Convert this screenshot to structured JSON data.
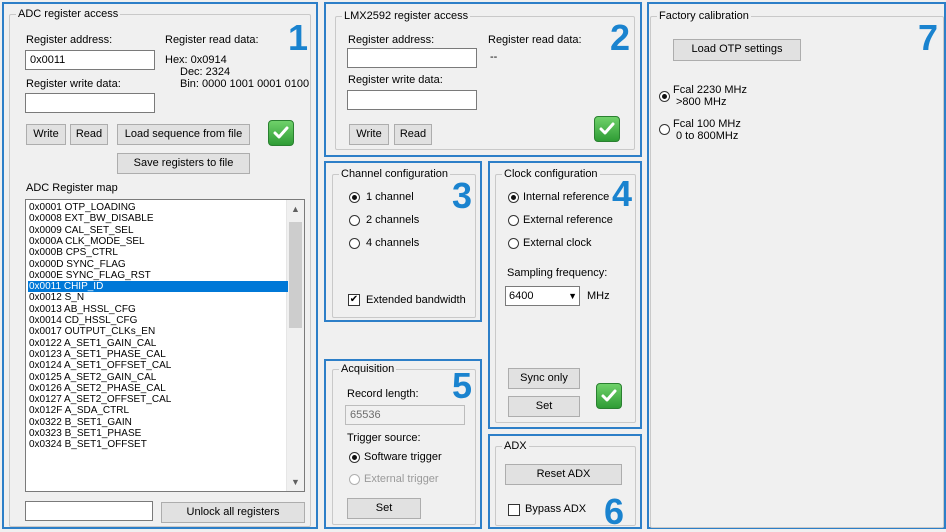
{
  "panel1": {
    "number": "1",
    "group_title": "ADC register access",
    "register_address_label": "Register address:",
    "register_address_value": "0x0011",
    "register_read_data_label": "Register read data:",
    "read_hex": "Hex: 0x0914",
    "read_dec": "Dec: 2324",
    "read_bin": "Bin: 0000 1001 0001 0100",
    "register_write_data_label": "Register write data:",
    "register_write_data_value": "",
    "write_button": "Write",
    "read_button": "Read",
    "load_sequence_button": "Load sequence from file",
    "save_registers_button": "Save registers to file",
    "register_map_label": "ADC Register map",
    "register_map": [
      "0x0001 OTP_LOADING",
      "0x0008 EXT_BW_DISABLE",
      "0x0009 CAL_SET_SEL",
      "0x000A CLK_MODE_SEL",
      "0x000B CPS_CTRL",
      "0x000D SYNC_FLAG",
      "0x000E SYNC_FLAG_RST",
      "0x0011 CHIP_ID",
      "0x0012 S_N",
      "0x0013 AB_HSSL_CFG",
      "0x0014 CD_HSSL_CFG",
      "0x0017 OUTPUT_CLKs_EN",
      "0x0122 A_SET1_GAIN_CAL",
      "0x0123 A_SET1_PHASE_CAL",
      "0x0124 A_SET1_OFFSET_CAL",
      "0x0125 A_SET2_GAIN_CAL",
      "0x0126 A_SET2_PHASE_CAL",
      "0x0127 A_SET2_OFFSET_CAL",
      "0x012F A_SDA_CTRL",
      "0x0322 B_SET1_GAIN",
      "0x0323 B_SET1_PHASE",
      "0x0324 B_SET1_OFFSET"
    ],
    "selected_index": 7,
    "unlock_input_value": "",
    "unlock_button": "Unlock all registers"
  },
  "panel2": {
    "number": "2",
    "group_title": "LMX2592 register access",
    "register_address_label": "Register address:",
    "register_address_value": "",
    "register_read_data_label": "Register read data:",
    "read_value": "--",
    "register_write_data_label": "Register write data:",
    "register_write_data_value": "",
    "write_button": "Write",
    "read_button": "Read"
  },
  "panel3": {
    "number": "3",
    "group_title": "Channel configuration",
    "options": [
      "1 channel",
      "2 channels",
      "4 channels"
    ],
    "selected_option": 0,
    "extended_bandwidth_label": "Extended bandwidth",
    "extended_bandwidth_checked": true
  },
  "panel4": {
    "number": "4",
    "group_title": "Clock configuration",
    "options": [
      "Internal reference",
      "External reference",
      "External clock"
    ],
    "selected_option": 0,
    "sampling_frequency_label": "Sampling frequency:",
    "sampling_frequency_value": "6400",
    "sampling_frequency_unit": "MHz",
    "sync_only_button": "Sync only",
    "set_button": "Set"
  },
  "panel5": {
    "number": "5",
    "group_title": "Acquisition",
    "record_length_label": "Record length:",
    "record_length_value": "65536",
    "trigger_source_label": "Trigger source:",
    "software_trigger_label": "Software trigger",
    "external_trigger_label": "External trigger",
    "set_button": "Set"
  },
  "panel6": {
    "number": "6",
    "group_title": "ADX",
    "reset_button": "Reset ADX",
    "bypass_label": "Bypass ADX",
    "bypass_checked": false
  },
  "panel7": {
    "number": "7",
    "group_title": "Factory calibration",
    "load_otp_button": "Load OTP settings",
    "fcal_2230_line1": "Fcal 2230 MHz",
    "fcal_2230_line2": ">800 MHz",
    "fcal_100_line1": "Fcal 100 MHz",
    "fcal_100_line2": "0 to 800MHz",
    "selected_option": 0
  },
  "colors": {
    "panel_border": "#2d7fc8",
    "panel_number": "#1a83cf",
    "selection": "#0078d7",
    "ok_check": "#3aa63f"
  }
}
